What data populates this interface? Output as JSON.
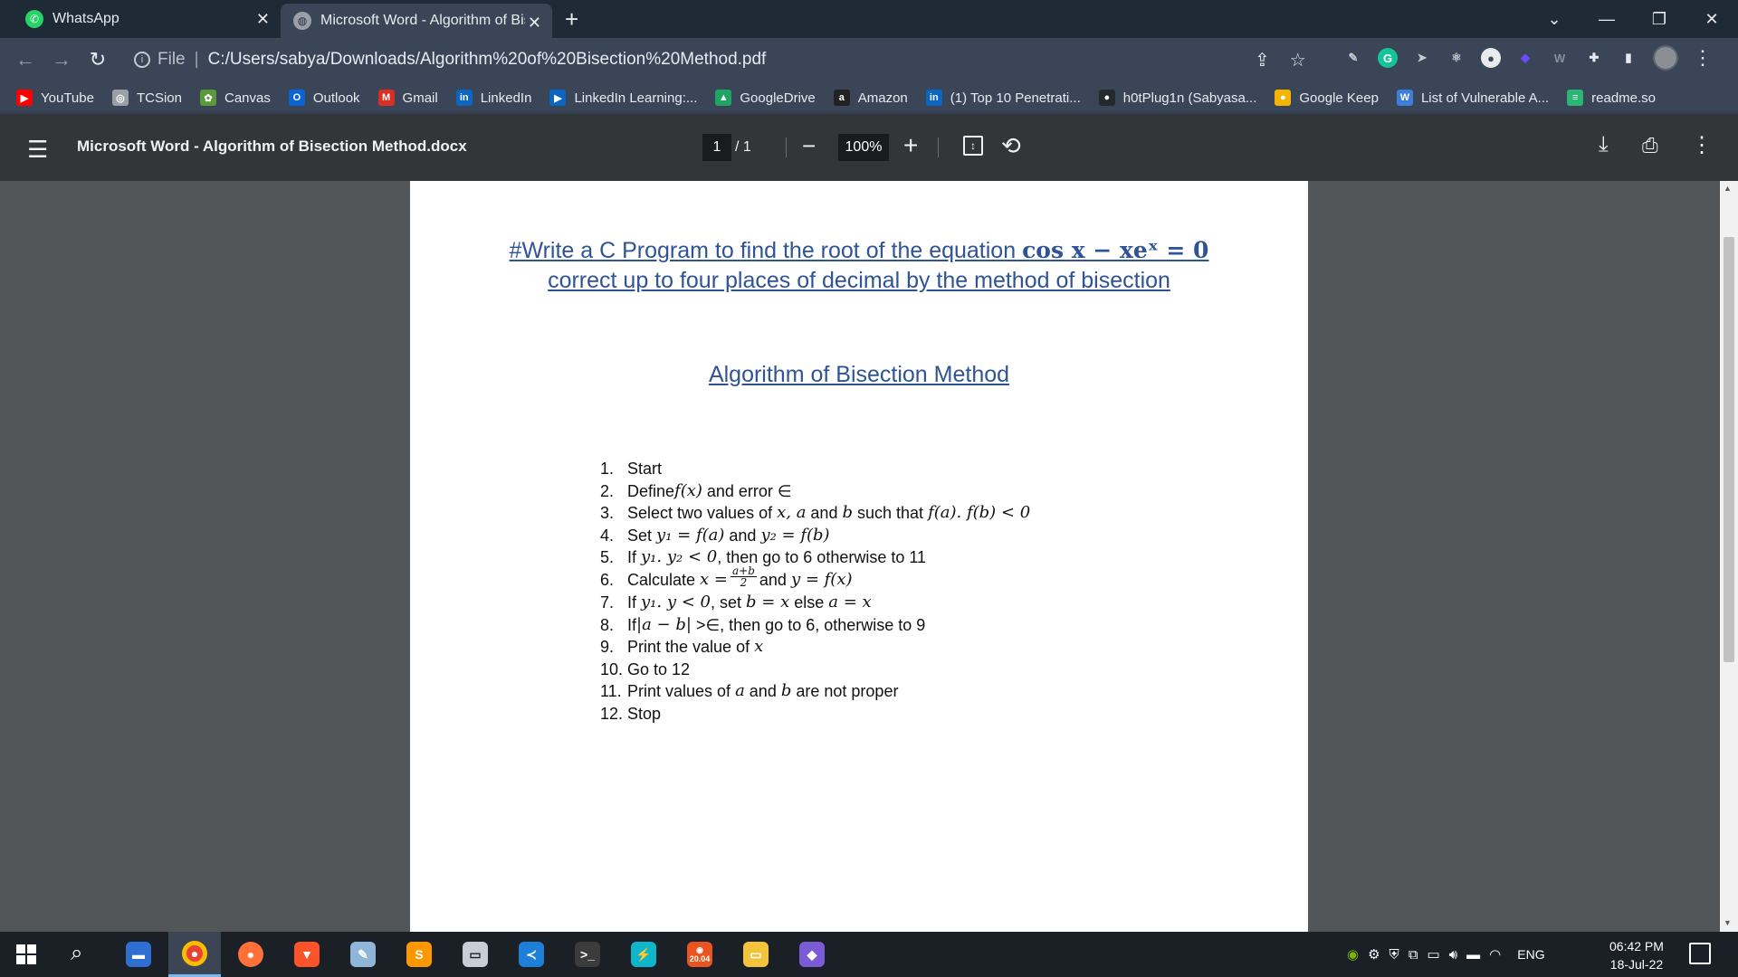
{
  "browser": {
    "tabs": [
      {
        "title": "WhatsApp",
        "icon": "whatsapp-icon"
      },
      {
        "title": "Microsoft Word - Algorithm of Bisection Method.docx",
        "icon": "globe-icon"
      }
    ],
    "new_tab": "+",
    "address": {
      "scheme": "File",
      "url": "C:/Users/sabya/Downloads/Algorithm%20of%20Bisection%20Method.pdf"
    },
    "bookmarks": [
      {
        "label": "YouTube",
        "color": "#ff0000",
        "glyph": "▶"
      },
      {
        "label": "TCSion",
        "color": "#9aa0a6",
        "glyph": "◎"
      },
      {
        "label": "Canvas",
        "color": "#5b9a3a",
        "glyph": "✿"
      },
      {
        "label": "Outlook",
        "color": "#0a64d6",
        "glyph": "O"
      },
      {
        "label": "Gmail",
        "color": "#d93025",
        "glyph": "M"
      },
      {
        "label": "LinkedIn",
        "color": "#0a66c2",
        "glyph": "in"
      },
      {
        "label": "LinkedIn Learning:...",
        "color": "#0a66c2",
        "glyph": "▶"
      },
      {
        "label": "GoogleDrive",
        "color": "#1fa463",
        "glyph": "▲"
      },
      {
        "label": "Amazon",
        "color": "#222222",
        "glyph": "a"
      },
      {
        "label": "(1) Top 10 Penetrati...",
        "color": "#0a66c2",
        "glyph": "in"
      },
      {
        "label": "h0tPlug1n (Sabyasa...",
        "color": "#24292e",
        "glyph": "●"
      },
      {
        "label": "Google Keep",
        "color": "#f6b400",
        "glyph": "●"
      },
      {
        "label": "List of Vulnerable A...",
        "color": "#3d7de0",
        "glyph": "W"
      },
      {
        "label": "readme.so",
        "color": "#2bb673",
        "glyph": "≡"
      }
    ]
  },
  "pdf": {
    "title": "Microsoft Word - Algorithm of Bisection Method.docx",
    "page_current": "1",
    "page_total": "/ 1",
    "zoom": "100%"
  },
  "document": {
    "heading_line1_text": "#Write a C Program to find the root of the equation ",
    "heading_math": "cos x − xeˣ = 0",
    "heading_line2": "correct up to four places of decimal by the method of bisection",
    "subheading": "Algorithm of Bisection Method",
    "steps": {
      "s1": {
        "num": "1.",
        "a": "Start"
      },
      "s2": {
        "num": "2.",
        "a": "Define ",
        "m1": "f(x)",
        "b": " and error ∈"
      },
      "s3": {
        "num": "3.",
        "a": "Select two values of ",
        "m1": "x, a",
        "b": " and ",
        "m2": "b",
        "c": " such that ",
        "m3": "f(a). f(b) < 0"
      },
      "s4": {
        "num": "4.",
        "a": "Set ",
        "m1": "y₁ = f(a)",
        "b": " and ",
        "m2": "y₂ = f(b)"
      },
      "s5": {
        "num": "5.",
        "a": "If ",
        "m1": "y₁. y₂ < 0",
        "b": ", then go to 6 otherwise to 11"
      },
      "s6": {
        "num": "6.",
        "a": "Calculate ",
        "m1": "x =",
        "frac_num": "a+b",
        "frac_den": "2",
        "b": "and ",
        "m2": "y = f(x)"
      },
      "s7": {
        "num": "7.",
        "a": "If ",
        "m1": "y₁. y < 0",
        "b": ", set ",
        "m2": "b = x",
        "c": " else ",
        "m3": "a = x"
      },
      "s8": {
        "num": "8.",
        "a": "If",
        "m1": "|a − b|",
        "b": " >∈, then go to 6, otherwise to 9"
      },
      "s9": {
        "num": "9.",
        "a": "Print the value of ",
        "m1": "x"
      },
      "s10": {
        "num": "10.",
        "a": "Go to 12"
      },
      "s11": {
        "num": "11.",
        "a": "Print values of ",
        "m1": "a",
        "b": " and ",
        "m2": "b",
        "c": " are not proper"
      },
      "s12": {
        "num": "12.",
        "a": "Stop"
      }
    }
  },
  "taskbar": {
    "apps": [
      "chrome",
      "firefox",
      "brave",
      "notepad",
      "sublime",
      "devices",
      "vscode",
      "terminal",
      "powerautomate",
      "ubuntu",
      "file-explorer",
      "obsidian"
    ],
    "ubuntu_label": "20.04",
    "tray_lang": "ENG",
    "time": "06:42 PM",
    "date": "18-Jul-22"
  }
}
